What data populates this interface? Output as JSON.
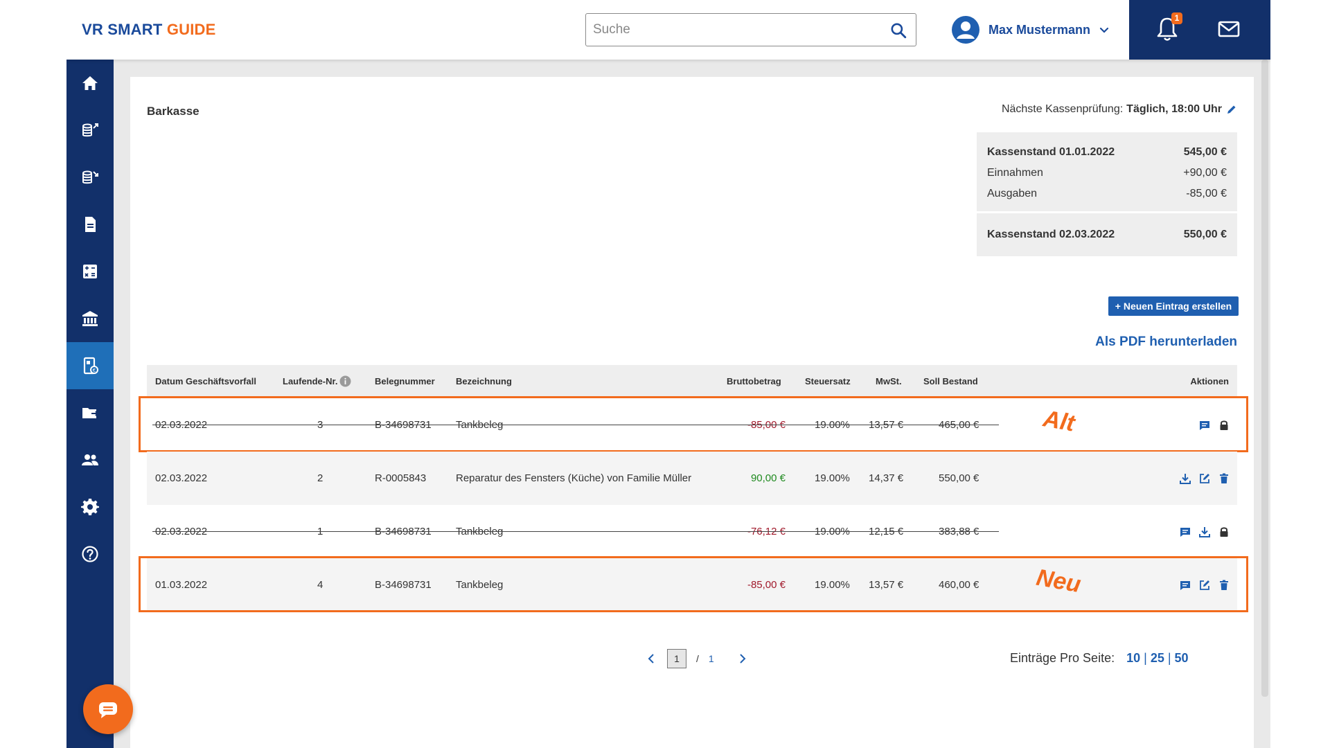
{
  "header": {
    "logo_main": "VR SMART ",
    "logo_accent": "GUIDE",
    "search_placeholder": "Suche",
    "user_name": "Max Mustermann",
    "notification_count": "1"
  },
  "sidebar": {
    "items": [
      {
        "icon": "home-icon"
      },
      {
        "icon": "income-icon"
      },
      {
        "icon": "expenses-icon"
      },
      {
        "icon": "document-icon"
      },
      {
        "icon": "calculator-icon"
      },
      {
        "icon": "bank-icon"
      },
      {
        "icon": "cash-register-icon",
        "active": true
      },
      {
        "icon": "folder-icon"
      },
      {
        "icon": "people-icon"
      },
      {
        "icon": "gear-icon"
      },
      {
        "icon": "help-icon"
      }
    ]
  },
  "page": {
    "title": "Barkasse",
    "pruefung_label": "Nächste Kassenprüfung:",
    "pruefung_value": "Täglich, 18:00 Uhr"
  },
  "summary": {
    "opening_label": "Kassenstand 01.01.2022",
    "opening_value": "545,00 €",
    "income_label": "Einnahmen",
    "income_value": "+90,00 €",
    "expenses_label": "Ausgaben",
    "expenses_value": "-85,00 €",
    "closing_label": "Kassenstand 02.03.2022",
    "closing_value": "550,00 €"
  },
  "actions": {
    "new_entry": "+ Neuen Eintrag erstellen",
    "pdf_download": "Als PDF herunterladen"
  },
  "table": {
    "headers": {
      "datum": "Datum Geschäftsvorfall",
      "laufende": "Laufende-Nr.",
      "beleg": "Belegnummer",
      "bezeichnung": "Bezeichnung",
      "brutto": "Bruttobetrag",
      "steuer": "Steuersatz",
      "mwst": "MwSt.",
      "soll": "Soll Bestand",
      "aktionen": "Aktionen"
    },
    "rows": [
      {
        "datum": "02.03.2022",
        "nr": "3",
        "beleg": "B-34698731",
        "bezeichnung": "Tankbeleg",
        "brutto": "-85,00 €",
        "steuer": "19.00%",
        "mwst": "13,57 €",
        "soll": "465,00 €",
        "struck": true,
        "sign": "neg"
      },
      {
        "datum": "02.03.2022",
        "nr": "2",
        "beleg": "R-0005843",
        "bezeichnung": "Reparatur des Fensters (Küche) von Familie Müller",
        "brutto": "90,00 €",
        "steuer": "19.00%",
        "mwst": "14,37 €",
        "soll": "550,00 €",
        "struck": false,
        "sign": "pos"
      },
      {
        "datum": "02.03.2022",
        "nr": "1",
        "beleg": "B-34698731",
        "bezeichnung": "Tankbeleg",
        "brutto": "-76,12 €",
        "steuer": "19.00%",
        "mwst": "12,15 €",
        "soll": "383,88 €",
        "struck": true,
        "sign": "neg"
      },
      {
        "datum": "01.03.2022",
        "nr": "4",
        "beleg": "B-34698731",
        "bezeichnung": "Tankbeleg",
        "brutto": "-85,00 €",
        "steuer": "19.00%",
        "mwst": "13,57 €",
        "soll": "460,00 €",
        "struck": false,
        "sign": "neg"
      }
    ]
  },
  "annotations": {
    "alt": "Alt",
    "neu": "Neu"
  },
  "pagination": {
    "current": "1",
    "separator": "/",
    "total": "1",
    "per_page_label": "Einträge Pro Seite:",
    "options": [
      "10",
      "25",
      "50"
    ],
    "selected": "10"
  },
  "colors": {
    "brand_blue": "#1a4a9b",
    "navy": "#12306a",
    "accent_orange": "#f26b1d",
    "negative": "#a11a2c",
    "positive": "#1f8a1f"
  }
}
